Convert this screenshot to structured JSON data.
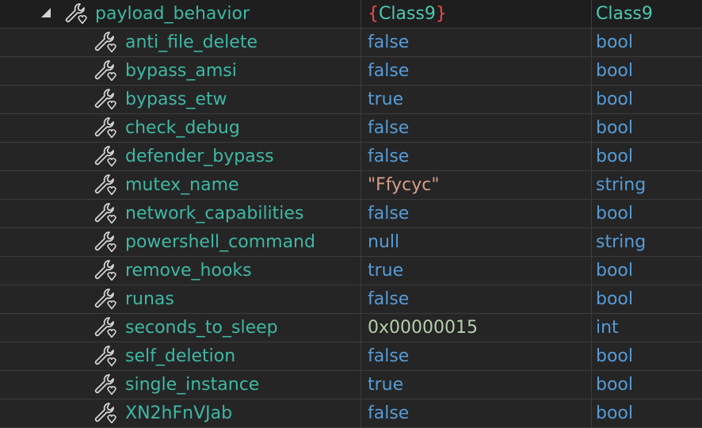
{
  "parent": {
    "name": "payload_behavior",
    "value_brace_open": "{",
    "value_class": "Class9",
    "value_brace_close": "}",
    "type": "Class9"
  },
  "rows": [
    {
      "name": "anti_file_delete",
      "value": "false",
      "value_kind": "bool",
      "type": "bool"
    },
    {
      "name": "bypass_amsi",
      "value": "false",
      "value_kind": "bool",
      "type": "bool"
    },
    {
      "name": "bypass_etw",
      "value": "true",
      "value_kind": "bool",
      "type": "bool"
    },
    {
      "name": "check_debug",
      "value": "false",
      "value_kind": "bool",
      "type": "bool"
    },
    {
      "name": "defender_bypass",
      "value": "false",
      "value_kind": "bool",
      "type": "bool"
    },
    {
      "name": "mutex_name",
      "value": "\"Ffycyc\"",
      "value_kind": "string",
      "type": "string"
    },
    {
      "name": "network_capabilities",
      "value": "false",
      "value_kind": "bool",
      "type": "bool"
    },
    {
      "name": "powershell_command",
      "value": "null",
      "value_kind": "bool",
      "type": "string"
    },
    {
      "name": "remove_hooks",
      "value": "true",
      "value_kind": "bool",
      "type": "bool"
    },
    {
      "name": "runas",
      "value": "false",
      "value_kind": "bool",
      "type": "bool"
    },
    {
      "name": "seconds_to_sleep",
      "value": "0x00000015",
      "value_kind": "num",
      "type": "int"
    },
    {
      "name": "self_deletion",
      "value": "false",
      "value_kind": "bool",
      "type": "bool"
    },
    {
      "name": "single_instance",
      "value": "true",
      "value_kind": "bool",
      "type": "bool"
    },
    {
      "name": "XN2hFnVJab",
      "value": "false",
      "value_kind": "bool",
      "type": "bool"
    }
  ],
  "icons": {
    "expander": "expanded-triangle-icon",
    "property": "wrench-property-icon"
  },
  "colors": {
    "name": "#3fb8a3",
    "bool": "#569cd6",
    "string": "#d69d85",
    "number": "#b5cea8",
    "brace": "#f14c4c",
    "class": "#4ec9b0"
  }
}
